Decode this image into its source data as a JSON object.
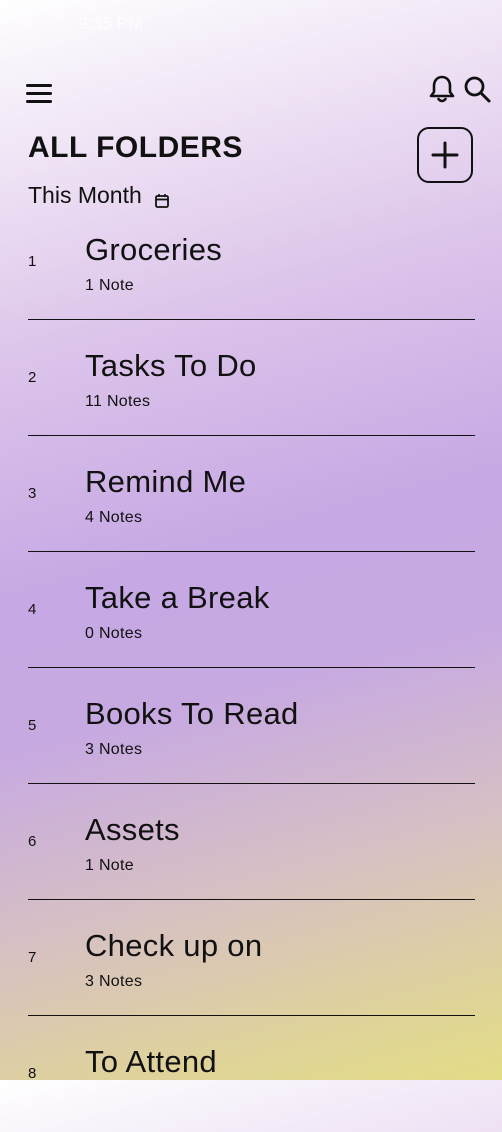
{
  "status_bar": {
    "time": "9:35 PM"
  },
  "header": {
    "title": "ALL FOLDERS",
    "period_label": "This Month"
  },
  "icons": {
    "menu": "hamburger-menu-icon",
    "notifications": "bell-icon",
    "search": "search-icon",
    "add": "plus-icon",
    "calendar": "calendar-icon"
  },
  "folders": [
    {
      "index": "1",
      "name": "Groceries",
      "count": "1 Note"
    },
    {
      "index": "2",
      "name": "Tasks To Do",
      "count": "11 Notes"
    },
    {
      "index": "3",
      "name": "Remind Me",
      "count": "4 Notes"
    },
    {
      "index": "4",
      "name": "Take a Break",
      "count": "0 Notes"
    },
    {
      "index": "5",
      "name": "Books To Read",
      "count": "3 Notes"
    },
    {
      "index": "6",
      "name": "Assets",
      "count": "1 Note"
    },
    {
      "index": "7",
      "name": "Check up on",
      "count": "3 Notes"
    },
    {
      "index": "8",
      "name": "To Attend",
      "count": ""
    }
  ]
}
